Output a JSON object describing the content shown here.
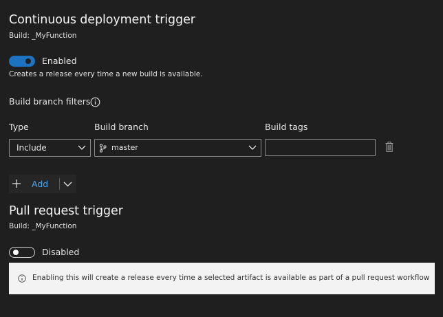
{
  "cd_trigger": {
    "title": "Continuous deployment trigger",
    "build_source": "Build: _MyFunction",
    "toggle_state": "Enabled",
    "toggle_on": true,
    "description": "Creates a release every time a new build is available."
  },
  "branch_filters": {
    "heading": "Build branch filters",
    "columns": {
      "type": "Type",
      "branch": "Build branch",
      "tags": "Build tags"
    },
    "row": {
      "type_value": "Include",
      "branch_value": "master",
      "tags_value": ""
    },
    "add_label": "Add"
  },
  "pr_trigger": {
    "title": "Pull request trigger",
    "build_source": "Build: _MyFunction",
    "toggle_state": "Disabled",
    "toggle_on": false,
    "info_text": "Enabling this will create a release every time a selected artifact is available as part of a pull request workflow"
  },
  "colors": {
    "background": "#1f1f1f",
    "toggle_on": "#1b73c2",
    "link": "#4ea6f5",
    "info_bg": "#f3f3f3"
  },
  "icons": [
    "info-icon",
    "chevron-down-icon",
    "branch-icon",
    "trash-icon",
    "plus-icon"
  ]
}
